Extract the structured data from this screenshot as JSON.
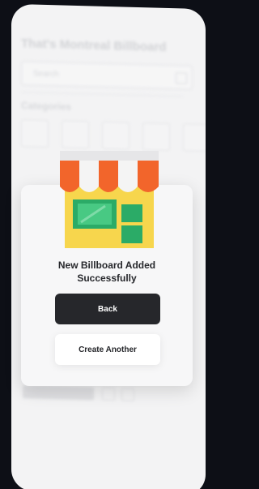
{
  "background": {
    "title": "That's Montreal Billboard",
    "search_placeholder": "Search",
    "categories_label": "Categories"
  },
  "modal": {
    "icon": "storefront-icon",
    "message_line1": "New Billboard Added",
    "message_line2": "Successfully",
    "back_label": "Back",
    "create_another_label": "Create Another"
  },
  "colors": {
    "awning_orange": "#f2652b",
    "awning_white": "#f4f4f4",
    "store_yellow": "#f7d64d",
    "store_green": "#2bab67",
    "dark_button": "#26272b"
  }
}
